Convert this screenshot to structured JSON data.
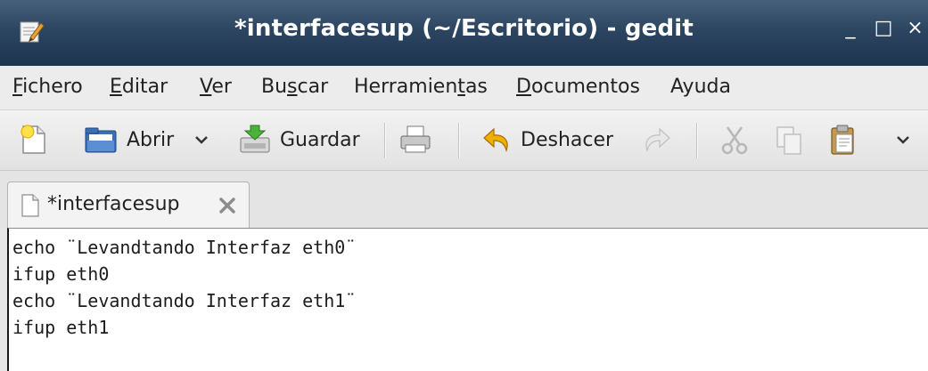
{
  "window": {
    "title": "*interfacesup (~/Escritorio) - gedit",
    "minimize_glyph": "_",
    "maximize_glyph": "□",
    "close_glyph": "×"
  },
  "menu": [
    {
      "label": "Fichero",
      "mnemonic": "F",
      "rest": "ichero"
    },
    {
      "label": "Editar",
      "mnemonic": "E",
      "rest": "ditar"
    },
    {
      "label": "Ver",
      "mnemonic": "V",
      "rest": "er"
    },
    {
      "label": "Buscar",
      "pre": "Bu",
      "mnemonic": "s",
      "rest": "car"
    },
    {
      "label": "Herramientas",
      "pre": "Herramien",
      "mnemonic": "t",
      "rest": "as"
    },
    {
      "label": "Documentos",
      "mnemonic": "D",
      "rest": "ocumentos"
    },
    {
      "label": "Ayuda",
      "mnemonic": "",
      "rest": "Ayuda"
    }
  ],
  "toolbar": {
    "open_label": "Abrir",
    "save_label": "Guardar",
    "undo_label": "Deshacer",
    "icons": [
      "new-document-icon",
      "open-folder-icon",
      "chevron-down-icon",
      "save-icon",
      "print-icon",
      "undo-icon",
      "redo-icon",
      "cut-icon",
      "copy-icon",
      "paste-icon",
      "overflow-chevron-icon"
    ]
  },
  "tab": {
    "label": "*interfacesup"
  },
  "editor": {
    "lines": [
      "echo ¨Levandtando Interfaz eth0¨",
      "ifup eth0",
      "echo ¨Levandtando Interfaz eth1¨",
      "ifup eth1"
    ]
  },
  "colors": {
    "titlebar": "#2c4560",
    "menubar": "#ececec",
    "toolbar": "#e6e6e6",
    "editor_bg": "#ffffff"
  }
}
